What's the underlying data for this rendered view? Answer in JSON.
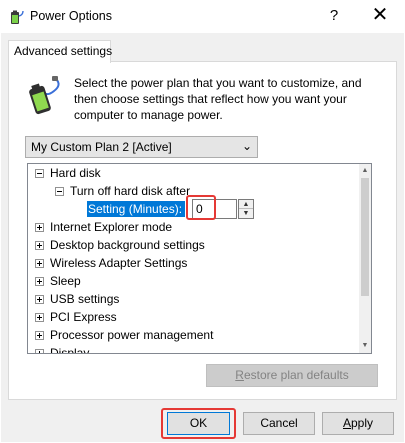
{
  "window": {
    "title": "Power Options",
    "help_glyph": "?",
    "close_glyph": "✕"
  },
  "tab": {
    "label": "Advanced settings"
  },
  "description": "Select the power plan that you want to customize, and then choose settings that reflect how you want your computer to manage power.",
  "plan_select": {
    "value": "My Custom Plan 2 [Active]",
    "chevron": "⌄"
  },
  "tree": {
    "hard_disk": "Hard disk",
    "turn_off": "Turn off hard disk after",
    "setting_label": "Setting (Minutes):",
    "setting_value": "0",
    "items": [
      "Internet Explorer mode",
      "Desktop background settings",
      "Wireless Adapter Settings",
      "Sleep",
      "USB settings",
      "PCI Express",
      "Processor power management",
      "Display"
    ]
  },
  "buttons": {
    "restore_first": "R",
    "restore_rest": "estore plan defaults",
    "ok": "OK",
    "cancel": "Cancel",
    "apply_first": "A",
    "apply_rest": "pply"
  },
  "icons": {
    "title": "power-options-icon",
    "description": "battery-plug-icon"
  },
  "colors": {
    "selection": "#0078d7",
    "highlight_box": "#e53935"
  }
}
